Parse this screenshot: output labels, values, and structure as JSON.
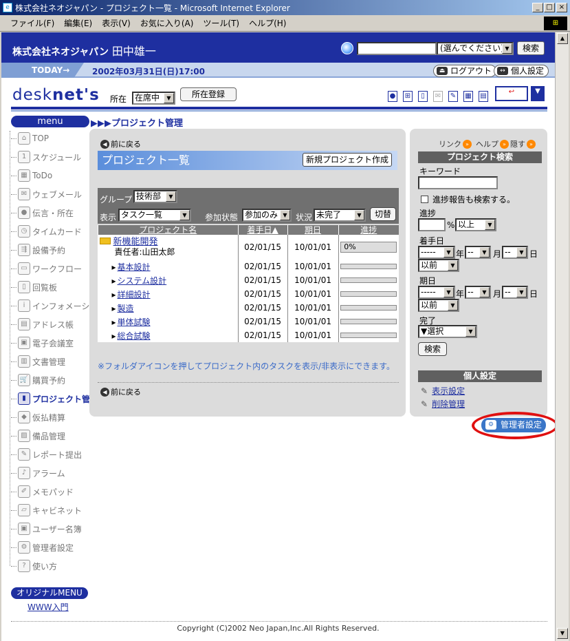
{
  "window": {
    "title": "株式会社ネオジャパン - プロジェクト一覧 - Microsoft Internet Explorer"
  },
  "menubar": [
    "ファイル(F)",
    "編集(E)",
    "表示(V)",
    "お気に入り(A)",
    "ツール(T)",
    "ヘルプ(H)"
  ],
  "header": {
    "company": "株式会社ネオジャパン",
    "user": "田中雄一",
    "scope": "(選んでください)",
    "search_button": "検索"
  },
  "todaybar": {
    "label": "TODAY",
    "date": "2002年03月31日(日)17:00",
    "logout": "ログアウト",
    "personal_settings": "個人設定"
  },
  "logo": {
    "text_thin": "desk",
    "text_bold": "net's"
  },
  "presence": {
    "label": "所在",
    "value": "在席中",
    "register": "所在登録"
  },
  "leftmenu": {
    "title": "menu",
    "items": [
      "TOP",
      "スケジュール",
      "ToDo",
      "ウェブメール",
      "伝言・所在",
      "タイムカード",
      "設備予約",
      "ワークフロー",
      "回覧板",
      "インフォメーション",
      "アドレス帳",
      "電子会議室",
      "文書管理",
      "購買予約",
      "プロジェクト管理",
      "仮払精算",
      "備品管理",
      "レポート提出",
      "アラーム",
      "メモパッド",
      "キャビネット",
      "ユーザー名簿",
      "管理者設定",
      "使い方"
    ],
    "active_index": 14,
    "original_menu": "オリジナルMENU",
    "www_link": "WWW入門"
  },
  "breadcrumb": "▶▶▶プロジェクト管理",
  "main": {
    "back": "前に戻る",
    "title": "プロジェクト一覧",
    "new_project": "新規プロジェクト作成",
    "filter": {
      "group_label": "グループ",
      "group_value": "技術部",
      "display_label": "表示",
      "display_value": "タスク一覧",
      "participation_label": "参加状態",
      "participation_value": "参加のみ",
      "status_label": "状況",
      "status_value": "未完了",
      "switch": "切替"
    },
    "columns": [
      "プロジェクト名",
      "着手日▲",
      "期日",
      "進捗"
    ],
    "project": {
      "name": "新機能開発",
      "owner": "責任者:山田太郎",
      "start": "02/01/15",
      "due": "10/01/01",
      "progress": "0%"
    },
    "tasks": [
      {
        "name": "基本設計",
        "start": "02/01/15",
        "due": "10/01/01"
      },
      {
        "name": "システム設計",
        "start": "02/01/15",
        "due": "10/01/01"
      },
      {
        "name": "詳細設計",
        "start": "02/01/15",
        "due": "10/01/01"
      },
      {
        "name": "製造",
        "start": "02/01/15",
        "due": "10/01/01"
      },
      {
        "name": "単体試験",
        "start": "02/01/15",
        "due": "10/01/01"
      },
      {
        "name": "総合試験",
        "start": "02/01/15",
        "due": "10/01/01"
      }
    ],
    "note": "※フォルダアイコンを押してプロジェクト内のタスクを表示/非表示にできます。"
  },
  "right": {
    "links": [
      "リンク",
      "ヘルプ",
      "隠す"
    ],
    "search_title": "プロジェクト検索",
    "keyword_label": "キーワード",
    "include_reports": "進捗報告も検索する。",
    "progress_label": "進捗",
    "percent": "%",
    "progress_cond": "以上",
    "start_label": "着手日",
    "due_label": "期日",
    "date_y": "-----",
    "date_m": "--",
    "date_d": "--",
    "year": "年",
    "month": "月",
    "day": "日",
    "before": "以前",
    "done_label": "完了",
    "done_value": "▼選択",
    "search_button": "検索",
    "personal_title": "個人設定",
    "display_settings": "表示設定",
    "delete_mgmt": "削除管理"
  },
  "admin_button": "管理者設定",
  "copyright": "Copyright (C)2002 Neo Japan,Inc.All Rights Reserved."
}
